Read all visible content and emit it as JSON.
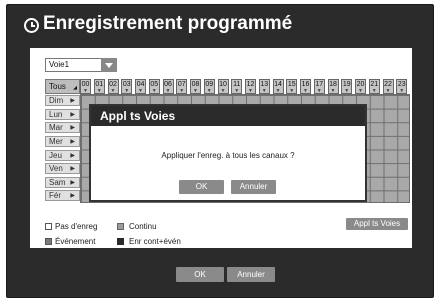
{
  "window": {
    "title": "Enregistrement programmé"
  },
  "channel": {
    "value": "Voie1"
  },
  "grid": {
    "tous_label": "Tous",
    "hours": [
      "00",
      "01",
      "02",
      "03",
      "04",
      "05",
      "06",
      "07",
      "08",
      "09",
      "10",
      "11",
      "12",
      "13",
      "14",
      "15",
      "16",
      "17",
      "18",
      "19",
      "20",
      "21",
      "22",
      "23"
    ],
    "days": [
      "Dim",
      "Lun",
      "Mar",
      "Mer",
      "Jeu",
      "Ven",
      "Sam",
      "Fér"
    ],
    "day_arrow": "▶",
    "hour_arrow": "▼",
    "tous_arrow": "◢"
  },
  "legend": {
    "none": "Pas d'enreg",
    "continuous": "Continu",
    "event": "Événement",
    "both": "Enr cont+évén"
  },
  "buttons": {
    "apply_all": "Appl ts Voies",
    "ok": "OK",
    "cancel": "Annuler"
  },
  "dialog": {
    "title": "Appl ts Voies",
    "message": "Appliquer l'enreg. à tous les canaux ?",
    "ok": "OK",
    "cancel": "Annuler"
  },
  "colors": {
    "window_bg": "#2b2b2b",
    "none": "#ffffff",
    "continuous": "#9c9c9c",
    "event": "#7a7a7a",
    "both": "#2a2a2a",
    "button": "#8a8a8a"
  }
}
